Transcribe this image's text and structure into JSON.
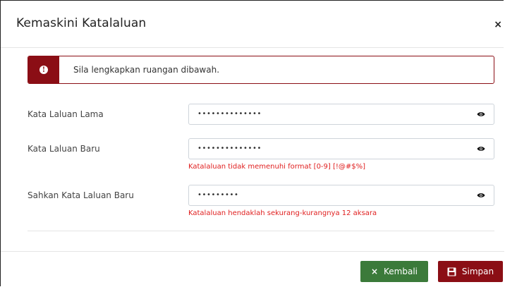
{
  "modal": {
    "title": "Kemaskini Katalaluan",
    "close_label": "×"
  },
  "alert": {
    "icon_glyph": "!",
    "message": "Sila lengkapkan ruangan dibawah."
  },
  "fields": [
    {
      "label": "Kata Laluan Lama",
      "value_masked": "••••••••••••••",
      "error": ""
    },
    {
      "label": "Kata Laluan Baru",
      "value_masked": "••••••••••••••",
      "error": "Katalaluan tidak memenuhi format [0-9] [!@#$%]"
    },
    {
      "label": "Sahkan Kata Laluan Baru",
      "value_masked": "•••••••••",
      "error": "Katalaluan hendaklah sekurang-kurangnya 12 aksara"
    }
  ],
  "footer": {
    "back_label": "Kembali",
    "back_icon": "×",
    "save_label": "Simpan"
  },
  "colors": {
    "danger": "#8b0e15",
    "success": "#3b7a3a",
    "error_text": "#e02020"
  },
  "icons": {
    "close": "close-icon",
    "alert": "info-circle-icon",
    "eye": "eye-icon",
    "back": "times-icon",
    "save": "floppy-disk-icon"
  }
}
